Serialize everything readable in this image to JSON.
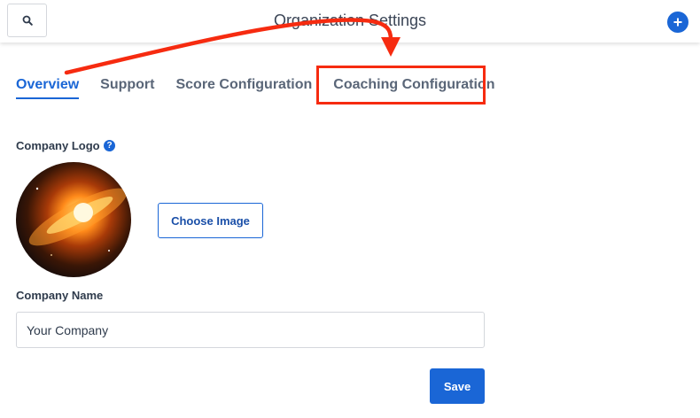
{
  "header": {
    "title": "Organization Settings",
    "search_icon": "search-icon",
    "add_icon": "plus-icon"
  },
  "tabs": [
    {
      "label": "Overview",
      "active": true
    },
    {
      "label": "Support",
      "active": false
    },
    {
      "label": "Score Configuration",
      "active": false
    },
    {
      "label": "Coaching Configuration",
      "active": false
    }
  ],
  "annotation": {
    "highlight_color": "#f62b10",
    "target_tab": "Coaching Configuration"
  },
  "logo_section": {
    "label": "Company Logo",
    "help_icon": "question-circle-icon",
    "choose_label": "Choose Image"
  },
  "name_section": {
    "label": "Company Name",
    "value": "Your Company"
  },
  "actions": {
    "save_label": "Save"
  },
  "colors": {
    "accent": "#1a66d6",
    "annotation": "#f62b10"
  }
}
